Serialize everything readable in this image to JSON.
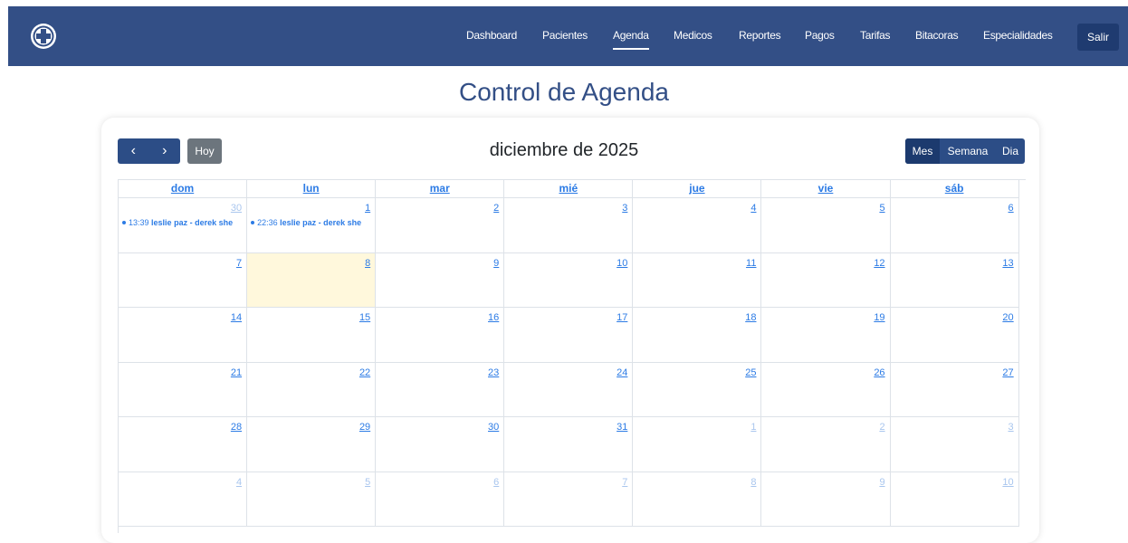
{
  "nav": {
    "items": [
      {
        "label": "Dashboard",
        "active": false
      },
      {
        "label": "Pacientes",
        "active": false
      },
      {
        "label": "Agenda",
        "active": true
      },
      {
        "label": "Medicos",
        "active": false
      },
      {
        "label": "Reportes",
        "active": false
      },
      {
        "label": "Pagos",
        "active": false
      },
      {
        "label": "Tarifas",
        "active": false
      },
      {
        "label": "Bitacoras",
        "active": false
      },
      {
        "label": "Especialidades",
        "active": false
      }
    ],
    "logout_label": "Salir",
    "logo_icon": "medical-cross-logo"
  },
  "page_title": "Control de Agenda",
  "calendar": {
    "prev_icon": "‹",
    "next_icon": "›",
    "today_label": "Hoy",
    "title": "diciembre de 2025",
    "views": [
      {
        "label": "Mes",
        "active": true
      },
      {
        "label": "Semana",
        "active": false
      },
      {
        "label": "Dia",
        "active": false
      }
    ],
    "weekdays": [
      "dom",
      "lun",
      "mar",
      "mié",
      "jue",
      "vie",
      "sáb"
    ],
    "weeks": [
      [
        {
          "day": "30",
          "other": true,
          "event": {
            "time": "13:39",
            "title": "leslie paz - derek she"
          }
        },
        {
          "day": "1",
          "other": false,
          "event": {
            "time": "22:36",
            "title": "leslie paz - derek she"
          }
        },
        {
          "day": "2",
          "other": false
        },
        {
          "day": "3",
          "other": false
        },
        {
          "day": "4",
          "other": false
        },
        {
          "day": "5",
          "other": false
        },
        {
          "day": "6",
          "other": false
        }
      ],
      [
        {
          "day": "7",
          "other": false
        },
        {
          "day": "8",
          "other": false,
          "today": true
        },
        {
          "day": "9",
          "other": false
        },
        {
          "day": "10",
          "other": false
        },
        {
          "day": "11",
          "other": false
        },
        {
          "day": "12",
          "other": false
        },
        {
          "day": "13",
          "other": false
        }
      ],
      [
        {
          "day": "14",
          "other": false
        },
        {
          "day": "15",
          "other": false
        },
        {
          "day": "16",
          "other": false
        },
        {
          "day": "17",
          "other": false
        },
        {
          "day": "18",
          "other": false
        },
        {
          "day": "19",
          "other": false
        },
        {
          "day": "20",
          "other": false
        }
      ],
      [
        {
          "day": "21",
          "other": false
        },
        {
          "day": "22",
          "other": false
        },
        {
          "day": "23",
          "other": false
        },
        {
          "day": "24",
          "other": false
        },
        {
          "day": "25",
          "other": false
        },
        {
          "day": "26",
          "other": false
        },
        {
          "day": "27",
          "other": false
        }
      ],
      [
        {
          "day": "28",
          "other": false
        },
        {
          "day": "29",
          "other": false
        },
        {
          "day": "30",
          "other": false
        },
        {
          "day": "31",
          "other": false
        },
        {
          "day": "1",
          "other": true
        },
        {
          "day": "2",
          "other": true
        },
        {
          "day": "3",
          "other": true
        }
      ],
      [
        {
          "day": "4",
          "other": true
        },
        {
          "day": "5",
          "other": true
        },
        {
          "day": "6",
          "other": true
        },
        {
          "day": "7",
          "other": true
        },
        {
          "day": "8",
          "other": true
        },
        {
          "day": "9",
          "other": true
        },
        {
          "day": "10",
          "other": true
        }
      ]
    ]
  },
  "colors": {
    "navbar": "#334f86",
    "accent": "#2c7be5",
    "today_bg": "#fff8dc",
    "today_btn": "#6c757d"
  }
}
